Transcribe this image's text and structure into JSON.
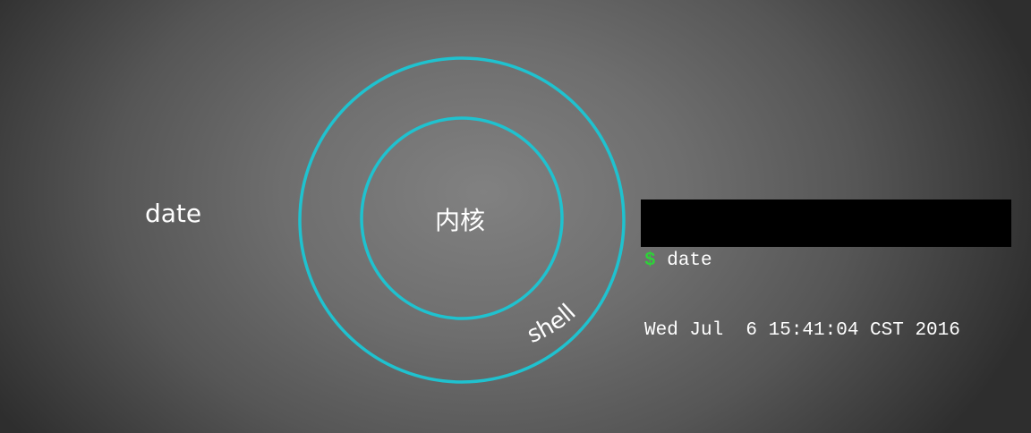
{
  "diagram": {
    "outside_label": "date",
    "kernel_label": "内核",
    "shell_label": "shell"
  },
  "terminal": {
    "prompt": "$",
    "command": "date",
    "output": "Wed Jul  6 15:41:04 CST 2016"
  },
  "colors": {
    "ring": "#1fc2cf",
    "prompt": "#2fd03a",
    "text": "#ffffff",
    "terminal_bg": "#000000"
  }
}
